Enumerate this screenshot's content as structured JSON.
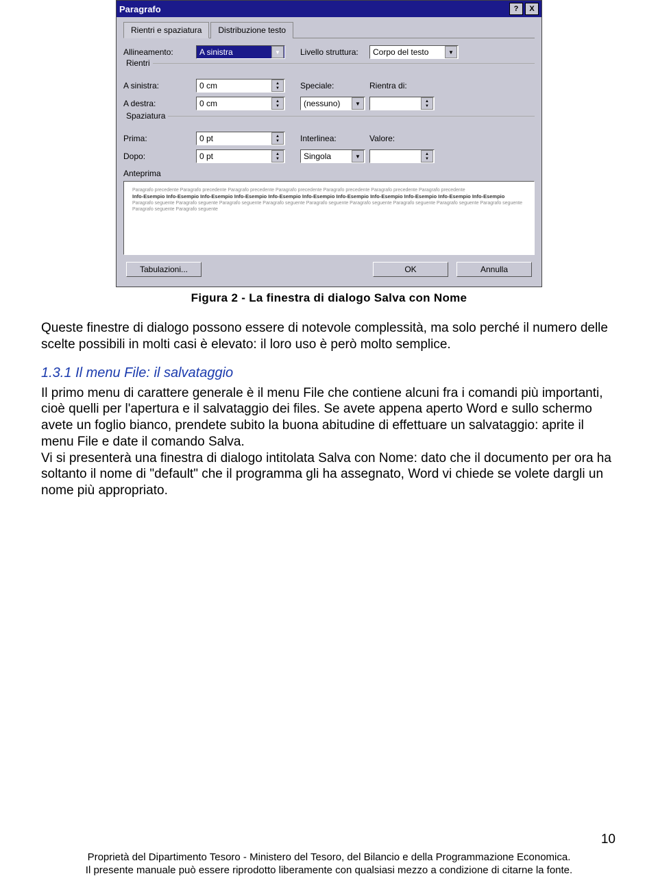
{
  "dialog": {
    "title": "Paragrafo",
    "tabs": {
      "indent": "Rientri e spaziatura",
      "dist": "Distribuzione testo"
    },
    "align_label": "Allineamento:",
    "align_value": "A sinistra",
    "level_label": "Livello struttura:",
    "level_value": "Corpo del testo",
    "group_rientri": "Rientri",
    "left_label": "A sinistra:",
    "left_value": "0 cm",
    "right_label": "A destra:",
    "right_value": "0 cm",
    "special_label": "Speciale:",
    "special_value": "(nessuno)",
    "by_label": "Rientra di:",
    "group_spaz": "Spaziatura",
    "before_label": "Prima:",
    "before_value": "0 pt",
    "after_label": "Dopo:",
    "after_value": "0 pt",
    "linespacing_label": "Interlinea:",
    "linespacing_value": "Singola",
    "at_label": "Valore:",
    "group_preview": "Anteprima",
    "btn_tabs": "Tabulazioni...",
    "btn_ok": "OK",
    "btn_cancel": "Annulla"
  },
  "caption": "Figura 2 - La finestra di dialogo Salva con Nome",
  "para1": "Queste finestre di dialogo possono essere di notevole complessità, ma solo perché il numero delle scelte possibili in molti casi è elevato: il loro uso è però molto semplice.",
  "heading": "1.3.1 Il menu File: il salvataggio",
  "para2": "Il primo menu di carattere generale è il menu File che contiene alcuni fra i comandi più importanti, cioè quelli per l'apertura e il salvataggio dei files. Se avete appena aperto Word e sullo schermo avete un foglio bianco, prendete subito la buona abitudine di effettuare un salvataggio: aprite il menu File e date il comando Salva.",
  "para3": "Vi si presenterà una finestra di dialogo intitolata Salva con Nome: dato che il documento per ora ha soltanto il nome di \"default\" che il programma gli ha assegnato, Word vi chiede se volete dargli un nome più appropriato.",
  "footer1": "Proprietà del Dipartimento Tesoro - Ministero del Tesoro, del Bilancio e della Programmazione Economica.",
  "footer2": "Il presente manuale può essere riprodotto liberamente con qualsiasi mezzo a condizione di citarne la fonte.",
  "pagenum": "10"
}
